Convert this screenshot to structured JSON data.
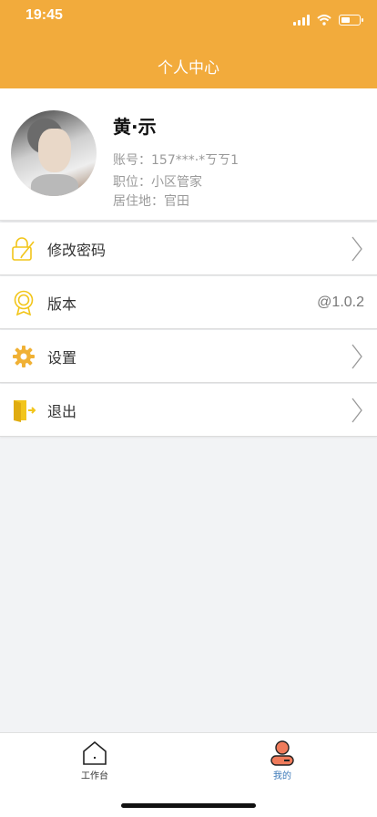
{
  "status_bar": {
    "time": "19:45"
  },
  "header": {
    "title": "个人中心"
  },
  "profile": {
    "name": "黄·示",
    "account": "账号：157***·*ㄎㄎ1",
    "position": "职位：小区管家",
    "residence": "居住地：官田"
  },
  "menu": {
    "items": [
      {
        "label": "修改密码",
        "icon": "lock-edit-icon"
      },
      {
        "label": "版本",
        "icon": "badge-icon",
        "value": "@1.0.2"
      },
      {
        "label": "设置",
        "icon": "gear-icon"
      },
      {
        "label": "退出",
        "icon": "exit-door-icon"
      }
    ]
  },
  "tabbar": {
    "items": [
      {
        "label": "工作台",
        "icon": "home-icon"
      },
      {
        "label": "我的",
        "icon": "user-icon",
        "active": true
      }
    ]
  },
  "colors": {
    "brand": "#f2ab3c",
    "icon_yellow": "#f2c51a",
    "tab_active": "#3b78b8"
  }
}
